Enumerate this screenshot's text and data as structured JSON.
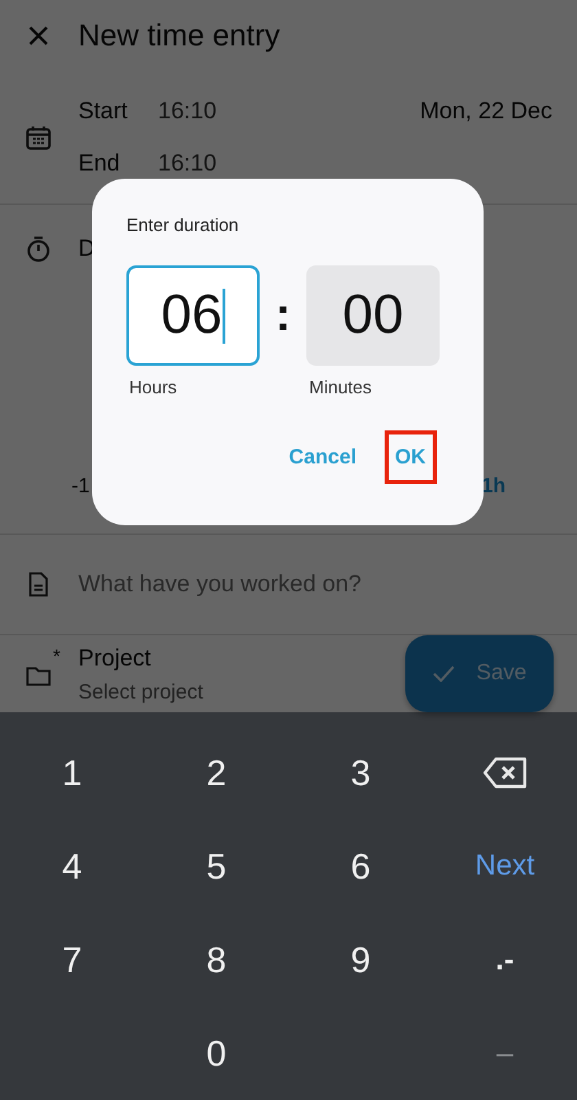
{
  "header": {
    "title": "New time entry"
  },
  "dates": {
    "start_label": "Start",
    "start_time": "16:10",
    "date": "Mon, 22 Dec",
    "end_label": "End",
    "end_time": "16:10"
  },
  "duration": {
    "label": "D",
    "minus_chip": "-1",
    "plus_chip": "1h"
  },
  "description": {
    "placeholder": "What have you worked on?"
  },
  "project": {
    "required_mark": "*",
    "label": "Project",
    "value": "Select project"
  },
  "save_button": {
    "label": "Save"
  },
  "dialog": {
    "title": "Enter duration",
    "fields": [
      {
        "value": "06",
        "label": "Hours",
        "focused": true
      },
      {
        "value": "00",
        "label": "Minutes",
        "focused": false
      }
    ],
    "separator": ":",
    "buttons": [
      {
        "label": "Cancel",
        "highlighted": false
      },
      {
        "label": "OK",
        "highlighted": true
      }
    ]
  },
  "keyboard": {
    "keys": [
      {
        "kind": "digit",
        "label": "1"
      },
      {
        "kind": "digit",
        "label": "2"
      },
      {
        "kind": "digit",
        "label": "3"
      },
      {
        "kind": "backspace"
      },
      {
        "kind": "digit",
        "label": "4"
      },
      {
        "kind": "digit",
        "label": "5"
      },
      {
        "kind": "digit",
        "label": "6"
      },
      {
        "kind": "action",
        "label": "Next"
      },
      {
        "kind": "digit",
        "label": "7"
      },
      {
        "kind": "digit",
        "label": "8"
      },
      {
        "kind": "digit",
        "label": "9"
      },
      {
        "kind": "symbol",
        "label": ".-"
      },
      {
        "kind": "blank"
      },
      {
        "kind": "digit",
        "label": "0"
      },
      {
        "kind": "blank"
      },
      {
        "kind": "muted",
        "label": "–"
      }
    ]
  }
}
